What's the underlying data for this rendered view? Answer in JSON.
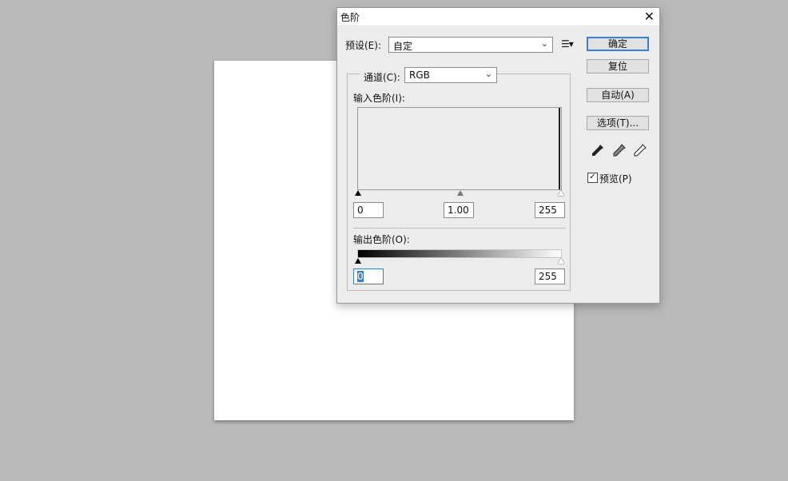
{
  "dialog": {
    "title": "色阶",
    "close_icon": "close-icon",
    "preset_label": "预设(E):",
    "preset_value": "自定",
    "channel_label": "通道(C):",
    "channel_value": "RGB",
    "input_levels_label": "输入色阶(I):",
    "input_black": "0",
    "input_mid": "1.00",
    "input_white": "255",
    "output_levels_label": "输出色阶(O):",
    "output_black": "0",
    "output_white": "255",
    "buttons": {
      "ok": "确定",
      "reset": "复位",
      "auto": "自动(A)",
      "options": "选项(T)..."
    },
    "preview_label": "预览(P)",
    "preview_checked": true
  }
}
